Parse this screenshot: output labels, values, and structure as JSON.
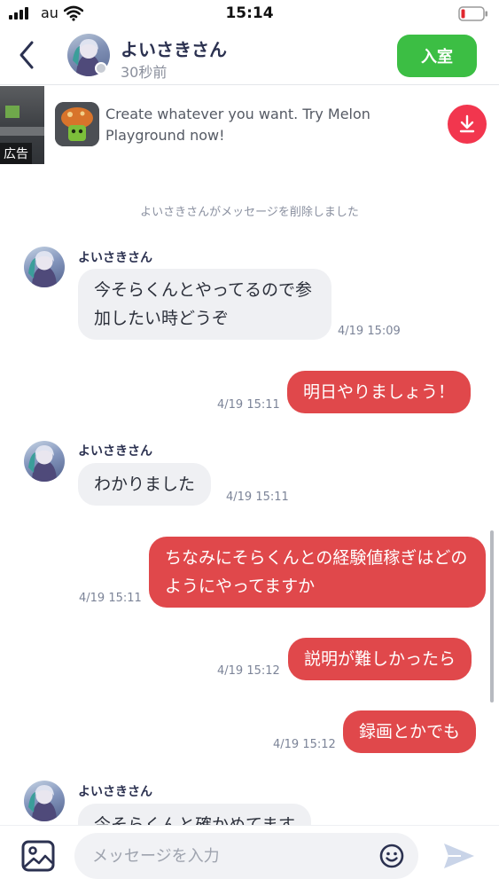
{
  "status_bar": {
    "carrier": "au",
    "time": "15:14"
  },
  "header": {
    "name": "よいさきさん",
    "last_seen": "30秒前",
    "enter_label": "入室"
  },
  "ad": {
    "badge": "広告",
    "text": "Create whatever you want. Try Melon Playground now!"
  },
  "system_message": "よいさきさんがメッセージを削除しました",
  "messages": [
    {
      "from": "other",
      "sender": "よいさきさん",
      "text": "今そらくんとやってるので参加したい時どうぞ",
      "time": "4/19 15:09"
    },
    {
      "from": "me",
      "text": "明日やりましょう！",
      "time": "4/19 15:11"
    },
    {
      "from": "other",
      "sender": "よいさきさん",
      "text": "わかりました",
      "time": "4/19 15:11"
    },
    {
      "from": "me",
      "text": "ちなみにそらくんとの経験値稼ぎはどのようにやってますか",
      "time": "4/19 15:11"
    },
    {
      "from": "me",
      "text": "説明が難しかったら",
      "time": "4/19 15:12"
    },
    {
      "from": "me",
      "text": "録画とかでも",
      "time": "4/19 15:12"
    },
    {
      "from": "other",
      "sender": "よいさきさん",
      "text": "今そらくんと確かめてます"
    }
  ],
  "input": {
    "placeholder": "メッセージを入力"
  },
  "colors": {
    "enter_button": "#3cbe44",
    "outgoing_bubble": "#e0484b",
    "incoming_bubble": "#eff0f3",
    "download_button": "#f2364e"
  }
}
